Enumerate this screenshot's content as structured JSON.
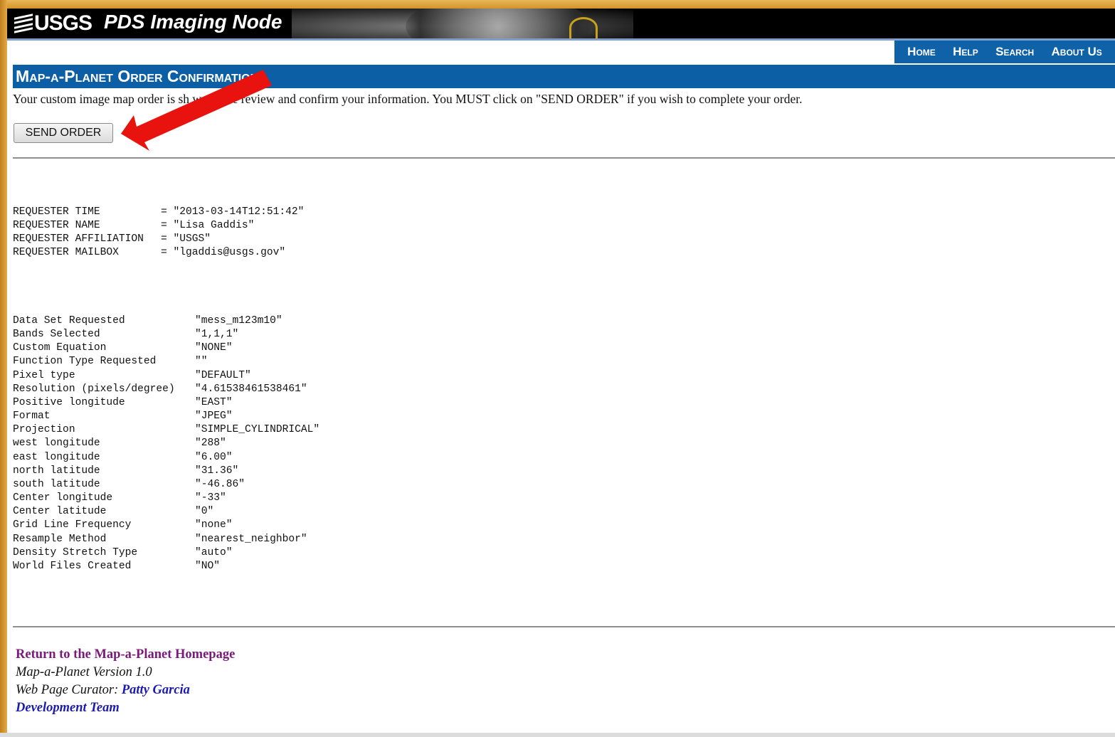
{
  "banner": {
    "logo_text": "USGS",
    "title": "PDS Imaging Node"
  },
  "nav": {
    "items": [
      "Home",
      "Help",
      "Search",
      "About Us"
    ]
  },
  "page_title": "Map-a-Planet Order Confirmation",
  "intro_text": "Your custom image map order is sh     w, please review and confirm your information. You MUST click on \"SEND ORDER\" if you wish to complete your order.",
  "send_button_label": "SEND ORDER",
  "requester": [
    {
      "key": "REQUESTER TIME",
      "value": "= \"2013-03-14T12:51:42\""
    },
    {
      "key": "REQUESTER NAME",
      "value": "= \"Lisa Gaddis\""
    },
    {
      "key": "REQUESTER AFFILIATION",
      "value": "= \"USGS\""
    },
    {
      "key": "REQUESTER MAILBOX",
      "value": "= \"lgaddis@usgs.gov\""
    }
  ],
  "order_params": [
    {
      "key": "Data Set Requested",
      "value": "\"mess_m123m10\""
    },
    {
      "key": "Bands Selected",
      "value": "\"1,1,1\""
    },
    {
      "key": "Custom Equation",
      "value": "\"NONE\""
    },
    {
      "key": "Function Type Requested",
      "value": "\"\""
    },
    {
      "key": "Pixel type",
      "value": "\"DEFAULT\""
    },
    {
      "key": "Resolution (pixels/degree)",
      "value": "\"4.61538461538461\""
    },
    {
      "key": "Positive longitude",
      "value": "\"EAST\""
    },
    {
      "key": "Format",
      "value": "\"JPEG\""
    },
    {
      "key": "Projection",
      "value": "\"SIMPLE_CYLINDRICAL\""
    },
    {
      "key": "west longitude",
      "value": "\"288\""
    },
    {
      "key": "east longitude",
      "value": "\"6.00\""
    },
    {
      "key": "north latitude",
      "value": "\"31.36\""
    },
    {
      "key": "south latitude",
      "value": "\"-46.86\""
    },
    {
      "key": "Center longitude",
      "value": "\"-33\""
    },
    {
      "key": "Center latitude",
      "value": "\"0\""
    },
    {
      "key": "Grid Line Frequency",
      "value": "\"none\""
    },
    {
      "key": "Resample Method",
      "value": "\"nearest_neighbor\""
    },
    {
      "key": "Density Stretch Type",
      "value": "\"auto\""
    },
    {
      "key": "World Files Created",
      "value": "\"NO\""
    }
  ],
  "footer": {
    "return_link": "Return to the Map-a-Planet Homepage",
    "version": "Map-a-Planet Version 1.0",
    "curator_label": "Web Page Curator:",
    "curator_name": "Patty Garcia",
    "dev_team": "Development Team"
  },
  "colors": {
    "nav_blue": "#1062a8",
    "title_blue": "#0c5fa5",
    "arrow_red": "#e8130f",
    "frame_gold": "#d99a2b"
  },
  "icons": [
    "usgs-logo-icon",
    "red-arrow-icon"
  ]
}
